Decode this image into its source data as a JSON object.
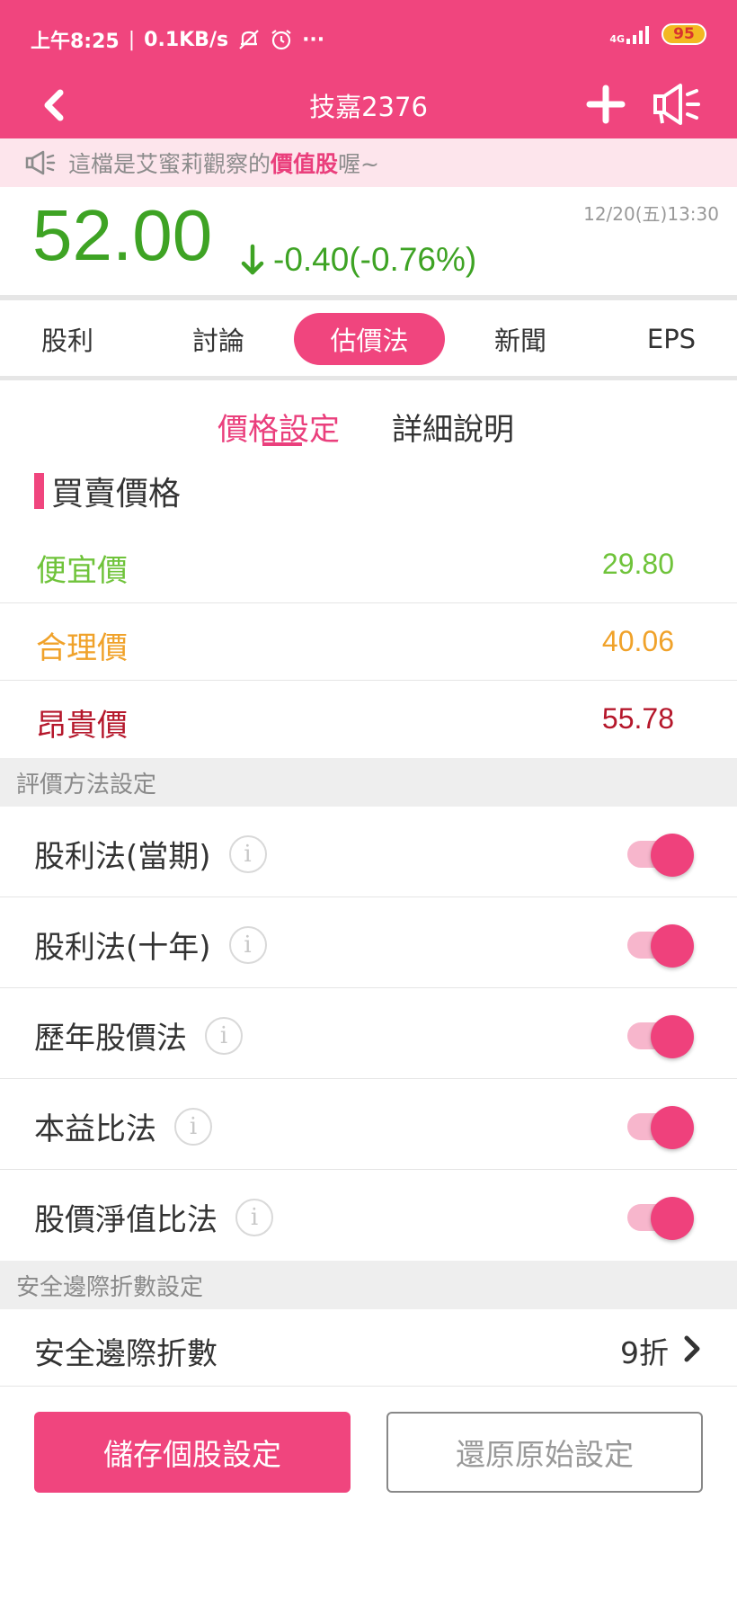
{
  "status_bar": {
    "time": "上午8:25",
    "speed": "0.1KB/s",
    "more": "···",
    "network": "4G",
    "battery": "95"
  },
  "header": {
    "back_icon": "chevron-left-icon",
    "title": "技嘉2376",
    "add_icon": "plus-icon",
    "announce_icon": "megaphone-icon"
  },
  "notice": {
    "prefix": "這檔是艾蜜莉觀察的",
    "highlight": "價值股",
    "suffix": "喔~"
  },
  "quote": {
    "datetime": "12/20(五)13:30",
    "price": "52.00",
    "change": "-0.40(-0.76%)",
    "color": "#3ea324"
  },
  "tabs": [
    {
      "label": "股利"
    },
    {
      "label": "討論"
    },
    {
      "label": "估價法"
    },
    {
      "label": "新聞"
    },
    {
      "label": "EPS"
    }
  ],
  "active_tab": "估價法",
  "subtabs": [
    {
      "label": "價格設定"
    },
    {
      "label": "詳細說明"
    }
  ],
  "section_title": "買賣價格",
  "prices": [
    {
      "label": "便宜價",
      "value": "29.80",
      "color": "#6fc33a"
    },
    {
      "label": "合理價",
      "value": "40.06",
      "color": "#f0a22a"
    },
    {
      "label": "昂貴價",
      "value": "55.78",
      "color": "#b5172b"
    }
  ],
  "methods_header": "評價方法設定",
  "methods": [
    {
      "label": "股利法(當期)",
      "enabled": true
    },
    {
      "label": "股利法(十年)",
      "enabled": true
    },
    {
      "label": "歷年股價法",
      "enabled": true
    },
    {
      "label": "本益比法",
      "enabled": true
    },
    {
      "label": "股價淨值比法",
      "enabled": true
    }
  ],
  "info_glyph": "i",
  "safety_header": "安全邊際折數設定",
  "safety": {
    "label": "安全邊際折數",
    "value": "9折"
  },
  "buttons": {
    "save": "儲存個股設定",
    "reset": "還原原始設定"
  },
  "colors": {
    "accent": "#f0457e",
    "up_down_green": "#3ea324"
  }
}
